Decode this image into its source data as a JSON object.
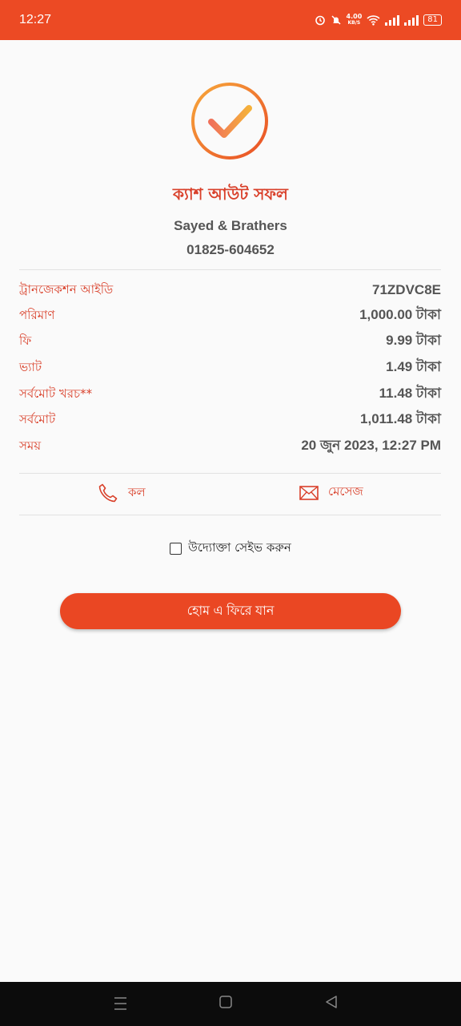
{
  "status_bar": {
    "time": "12:27",
    "net_speed_value": "4.00",
    "net_speed_unit": "KB/S",
    "battery": "81",
    "color": "#ec4a24"
  },
  "result": {
    "icon": "check-circle-icon",
    "title": "ক্যাশ আউট সফল",
    "merchant_name": "Sayed & Brathers",
    "merchant_phone": "01825-604652"
  },
  "details": [
    {
      "label": "ট্রানজেকশন আইডি",
      "value": "71ZDVC8E"
    },
    {
      "label": "পরিমাণ",
      "value": "1,000.00 টাকা"
    },
    {
      "label": "ফি",
      "value": "9.99 টাকা"
    },
    {
      "label": "ভ্যাট",
      "value": "1.49 টাকা"
    },
    {
      "label": "সর্বমোট খরচ**",
      "value": "11.48 টাকা"
    },
    {
      "label": "সর্বমোট",
      "value": "1,011.48 টাকা"
    },
    {
      "label": "সময়",
      "value": "20 জুন 2023, 12:27 PM"
    }
  ],
  "actions": {
    "call_label": "কল",
    "message_label": "মেসেজ"
  },
  "save_merchant": {
    "label": "উদ্যোক্তা সেইভ করুন",
    "checked": false
  },
  "home_button_label": "হোম এ ফিরে যান",
  "accent_color": "#d9402a"
}
